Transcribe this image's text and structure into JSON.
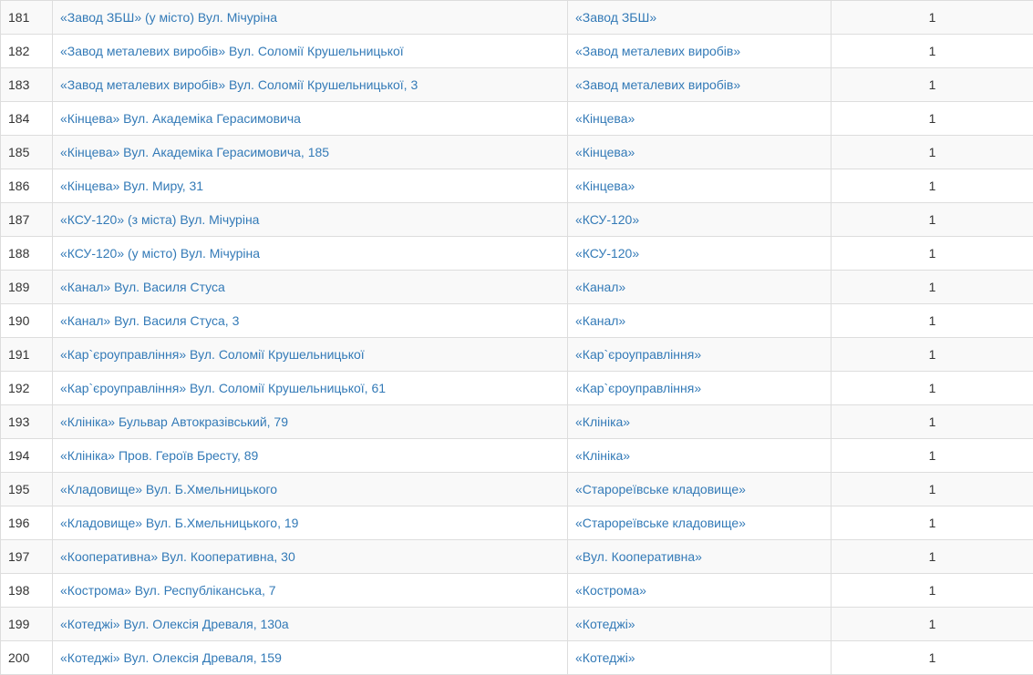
{
  "table": {
    "rows": [
      {
        "num": "181",
        "stop": "«Завод ЗБШ» (у місто) Вул. Мічуріна",
        "group": "«Завод ЗБШ»",
        "count": "1"
      },
      {
        "num": "182",
        "stop": "«Завод металевих виробів» Вул. Соломії Крушельницької",
        "group": "«Завод металевих виробів»",
        "count": "1"
      },
      {
        "num": "183",
        "stop": "«Завод металевих виробів» Вул. Соломії Крушельницької, 3",
        "group": "«Завод металевих виробів»",
        "count": "1"
      },
      {
        "num": "184",
        "stop": "«Кінцева» Вул. Академіка Герасимовича",
        "group": "«Кінцева»",
        "count": "1"
      },
      {
        "num": "185",
        "stop": "«Кінцева» Вул. Академіка Герасимовича, 185",
        "group": "«Кінцева»",
        "count": "1"
      },
      {
        "num": "186",
        "stop": "«Кінцева» Вул. Миру, 31",
        "group": "«Кінцева»",
        "count": "1"
      },
      {
        "num": "187",
        "stop": "«КСУ-120» (з міста) Вул. Мічуріна",
        "group": "«КСУ-120»",
        "count": "1"
      },
      {
        "num": "188",
        "stop": "«КСУ-120» (у місто) Вул. Мічуріна",
        "group": "«КСУ-120»",
        "count": "1"
      },
      {
        "num": "189",
        "stop": "«Канал» Вул. Василя Стуса",
        "group": "«Канал»",
        "count": "1"
      },
      {
        "num": "190",
        "stop": "«Канал» Вул. Василя Стуса, 3",
        "group": "«Канал»",
        "count": "1"
      },
      {
        "num": "191",
        "stop": "«Кар`єроуправління» Вул. Соломії Крушельницької",
        "group": "«Кар`єроуправління»",
        "count": "1"
      },
      {
        "num": "192",
        "stop": "«Кар`єроуправління» Вул. Соломії Крушельницької, 61",
        "group": "«Кар`єроуправління»",
        "count": "1"
      },
      {
        "num": "193",
        "stop": "«Клініка» Бульвар Автокразівський, 79",
        "group": "«Клініка»",
        "count": "1"
      },
      {
        "num": "194",
        "stop": "«Клініка» Пров. Героїв Бресту, 89",
        "group": "«Клініка»",
        "count": "1"
      },
      {
        "num": "195",
        "stop": "«Кладовище» Вул. Б.Хмельницького",
        "group": "«Старореївське кладовище»",
        "count": "1"
      },
      {
        "num": "196",
        "stop": "«Кладовище» Вул. Б.Хмельницького, 19",
        "group": "«Старореївське кладовище»",
        "count": "1"
      },
      {
        "num": "197",
        "stop": "«Кооперативна» Вул. Кооперативна, 30",
        "group": "«Вул. Кооперативна»",
        "count": "1"
      },
      {
        "num": "198",
        "stop": "«Кострома» Вул. Республіканська, 7",
        "group": "«Кострома»",
        "count": "1"
      },
      {
        "num": "199",
        "stop": "«Котеджі» Вул. Олексія Древаля, 130а",
        "group": "«Котеджі»",
        "count": "1"
      },
      {
        "num": "200",
        "stop": "«Котеджі» Вул. Олексія Древаля, 159",
        "group": "«Котеджі»",
        "count": "1"
      }
    ]
  },
  "colors": {
    "link": "#337ab7",
    "text": "#333333",
    "border": "#dddddd",
    "stripe": "#f9f9f9"
  }
}
